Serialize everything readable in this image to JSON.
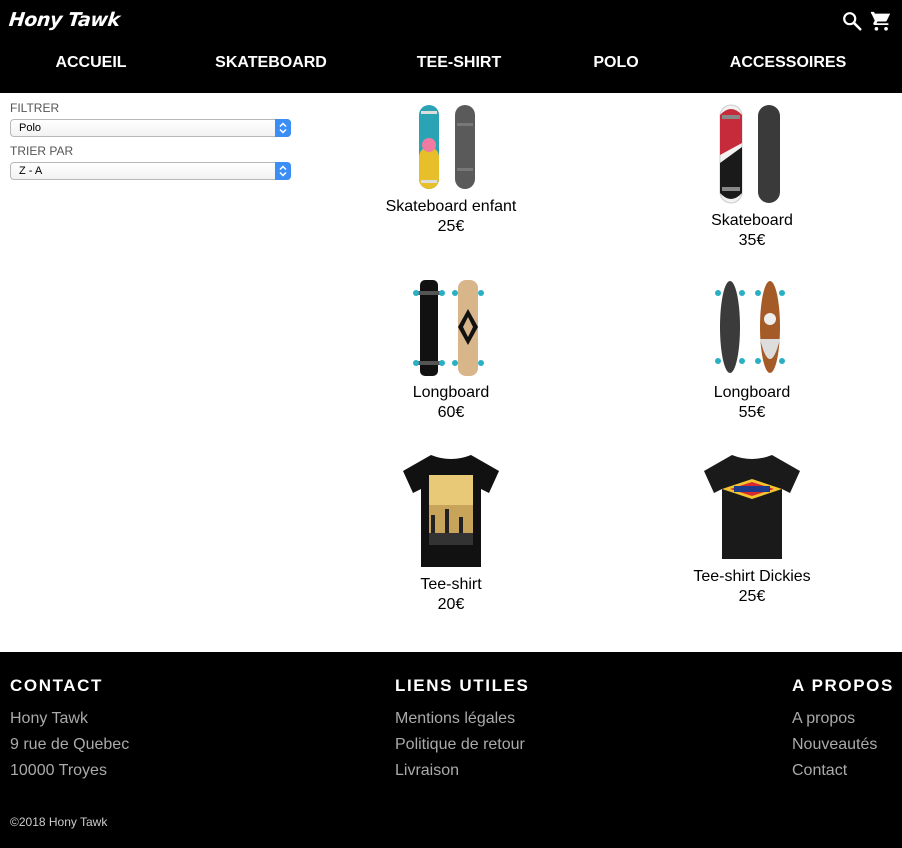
{
  "header": {
    "logo": "Hony Tawk",
    "icons": [
      "search-icon",
      "cart-icon"
    ],
    "nav": [
      "ACCUEIL",
      "SKATEBOARD",
      "TEE-SHIRT",
      "POLO",
      "ACCESSOIRES"
    ]
  },
  "filters": {
    "filter_label": "FILTRER",
    "filter_value": "Polo",
    "sort_label": "TRIER PAR",
    "sort_value": "Z - A",
    "accent": "#3d8ef4"
  },
  "products": [
    {
      "name": "Skateboard enfant",
      "price": "25€",
      "image": "skateboard-teal-yellow"
    },
    {
      "name": "Skateboard",
      "price": "35€",
      "image": "skateboard-red-white"
    },
    {
      "name": "Longboard",
      "price": "60€",
      "image": "longboard-black-tan"
    },
    {
      "name": "Longboard",
      "price": "55€",
      "image": "longboard-pintail"
    },
    {
      "name": "Tee-shirt",
      "price": "20€",
      "image": "tshirt-palm-print"
    },
    {
      "name": "Tee-shirt Dickies",
      "price": "25€",
      "image": "tshirt-dickies-logo"
    }
  ],
  "footer": {
    "contact": {
      "title": "CONTACT",
      "lines": [
        "Hony Tawk",
        "9 rue de Quebec",
        "10000 Troyes"
      ]
    },
    "links": {
      "title": "LIENS UTILES",
      "items": [
        "Mentions légales",
        "Politique de retour",
        "Livraison"
      ]
    },
    "about": {
      "title": "A PROPOS",
      "items": [
        "A propos",
        "Nouveautés",
        "Contact"
      ]
    },
    "copyright": "©2018 Hony Tawk"
  }
}
